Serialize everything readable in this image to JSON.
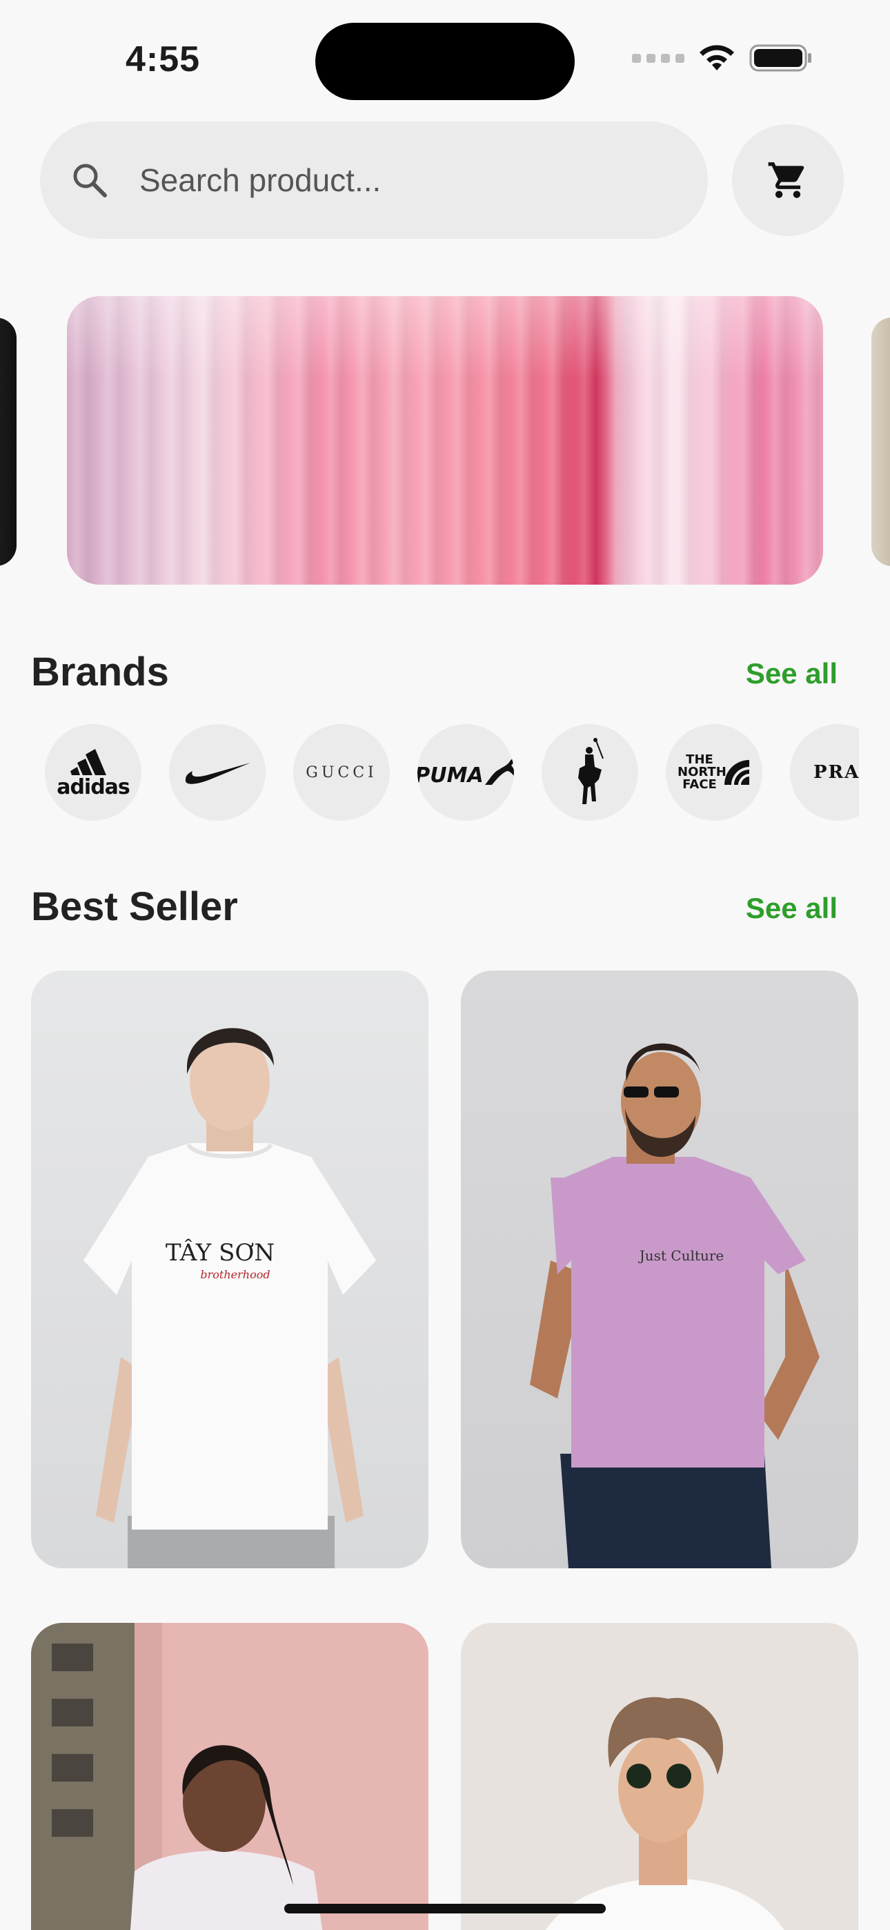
{
  "status_bar": {
    "time": "4:55"
  },
  "search": {
    "placeholder": "Search product..."
  },
  "icons": {
    "search": "search-icon",
    "cart": "cart-icon",
    "wifi": "wifi-icon",
    "battery": "battery-icon"
  },
  "brands": {
    "title": "Brands",
    "see_all": "See all",
    "items": [
      {
        "name": "adidas",
        "label": "adidas"
      },
      {
        "name": "nike",
        "label": ""
      },
      {
        "name": "gucci",
        "label": "GUCCI"
      },
      {
        "name": "puma",
        "label": "PUMA"
      },
      {
        "name": "ralph-lauren",
        "label": ""
      },
      {
        "name": "the-north-face",
        "label": "THE NORTH FACE"
      },
      {
        "name": "prada",
        "label": "PRAD"
      }
    ]
  },
  "best_seller": {
    "title": "Best Seller",
    "see_all": "See all",
    "products": [
      {
        "shirt_text": "TÂY SƠN",
        "shirt_subtext": "brotherhood"
      },
      {
        "shirt_text": "Just Culture"
      },
      {
        "shirt_text": ""
      },
      {
        "shirt_text": ""
      }
    ]
  },
  "colors": {
    "accent": "#2e9e2a",
    "chip_bg": "#ebebeb",
    "page_bg": "#f8f8f8"
  }
}
